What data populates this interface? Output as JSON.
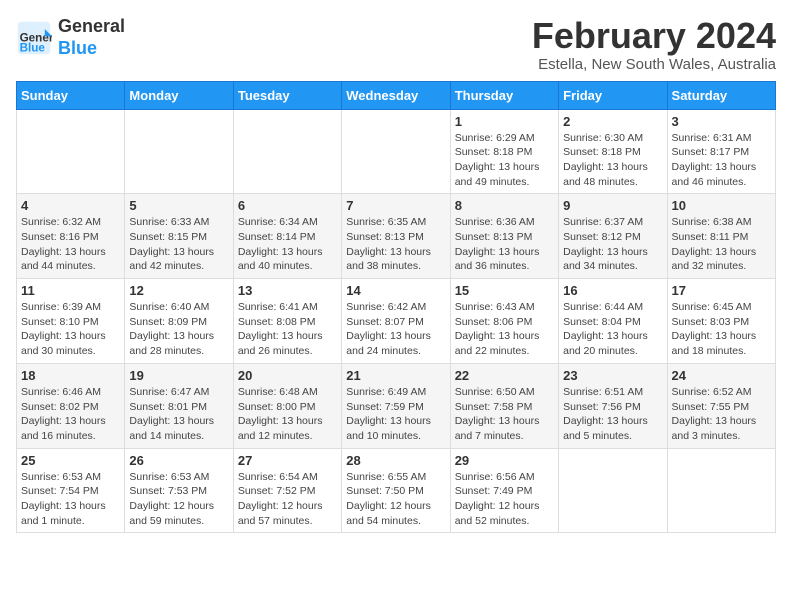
{
  "header": {
    "logo_general": "General",
    "logo_blue": "Blue",
    "month_title": "February 2024",
    "location": "Estella, New South Wales, Australia"
  },
  "days_of_week": [
    "Sunday",
    "Monday",
    "Tuesday",
    "Wednesday",
    "Thursday",
    "Friday",
    "Saturday"
  ],
  "weeks": [
    [
      {
        "day": "",
        "info": ""
      },
      {
        "day": "",
        "info": ""
      },
      {
        "day": "",
        "info": ""
      },
      {
        "day": "",
        "info": ""
      },
      {
        "day": "1",
        "info": "Sunrise: 6:29 AM\nSunset: 8:18 PM\nDaylight: 13 hours\nand 49 minutes."
      },
      {
        "day": "2",
        "info": "Sunrise: 6:30 AM\nSunset: 8:18 PM\nDaylight: 13 hours\nand 48 minutes."
      },
      {
        "day": "3",
        "info": "Sunrise: 6:31 AM\nSunset: 8:17 PM\nDaylight: 13 hours\nand 46 minutes."
      }
    ],
    [
      {
        "day": "4",
        "info": "Sunrise: 6:32 AM\nSunset: 8:16 PM\nDaylight: 13 hours\nand 44 minutes."
      },
      {
        "day": "5",
        "info": "Sunrise: 6:33 AM\nSunset: 8:15 PM\nDaylight: 13 hours\nand 42 minutes."
      },
      {
        "day": "6",
        "info": "Sunrise: 6:34 AM\nSunset: 8:14 PM\nDaylight: 13 hours\nand 40 minutes."
      },
      {
        "day": "7",
        "info": "Sunrise: 6:35 AM\nSunset: 8:13 PM\nDaylight: 13 hours\nand 38 minutes."
      },
      {
        "day": "8",
        "info": "Sunrise: 6:36 AM\nSunset: 8:13 PM\nDaylight: 13 hours\nand 36 minutes."
      },
      {
        "day": "9",
        "info": "Sunrise: 6:37 AM\nSunset: 8:12 PM\nDaylight: 13 hours\nand 34 minutes."
      },
      {
        "day": "10",
        "info": "Sunrise: 6:38 AM\nSunset: 8:11 PM\nDaylight: 13 hours\nand 32 minutes."
      }
    ],
    [
      {
        "day": "11",
        "info": "Sunrise: 6:39 AM\nSunset: 8:10 PM\nDaylight: 13 hours\nand 30 minutes."
      },
      {
        "day": "12",
        "info": "Sunrise: 6:40 AM\nSunset: 8:09 PM\nDaylight: 13 hours\nand 28 minutes."
      },
      {
        "day": "13",
        "info": "Sunrise: 6:41 AM\nSunset: 8:08 PM\nDaylight: 13 hours\nand 26 minutes."
      },
      {
        "day": "14",
        "info": "Sunrise: 6:42 AM\nSunset: 8:07 PM\nDaylight: 13 hours\nand 24 minutes."
      },
      {
        "day": "15",
        "info": "Sunrise: 6:43 AM\nSunset: 8:06 PM\nDaylight: 13 hours\nand 22 minutes."
      },
      {
        "day": "16",
        "info": "Sunrise: 6:44 AM\nSunset: 8:04 PM\nDaylight: 13 hours\nand 20 minutes."
      },
      {
        "day": "17",
        "info": "Sunrise: 6:45 AM\nSunset: 8:03 PM\nDaylight: 13 hours\nand 18 minutes."
      }
    ],
    [
      {
        "day": "18",
        "info": "Sunrise: 6:46 AM\nSunset: 8:02 PM\nDaylight: 13 hours\nand 16 minutes."
      },
      {
        "day": "19",
        "info": "Sunrise: 6:47 AM\nSunset: 8:01 PM\nDaylight: 13 hours\nand 14 minutes."
      },
      {
        "day": "20",
        "info": "Sunrise: 6:48 AM\nSunset: 8:00 PM\nDaylight: 13 hours\nand 12 minutes."
      },
      {
        "day": "21",
        "info": "Sunrise: 6:49 AM\nSunset: 7:59 PM\nDaylight: 13 hours\nand 10 minutes."
      },
      {
        "day": "22",
        "info": "Sunrise: 6:50 AM\nSunset: 7:58 PM\nDaylight: 13 hours\nand 7 minutes."
      },
      {
        "day": "23",
        "info": "Sunrise: 6:51 AM\nSunset: 7:56 PM\nDaylight: 13 hours\nand 5 minutes."
      },
      {
        "day": "24",
        "info": "Sunrise: 6:52 AM\nSunset: 7:55 PM\nDaylight: 13 hours\nand 3 minutes."
      }
    ],
    [
      {
        "day": "25",
        "info": "Sunrise: 6:53 AM\nSunset: 7:54 PM\nDaylight: 13 hours\nand 1 minute."
      },
      {
        "day": "26",
        "info": "Sunrise: 6:53 AM\nSunset: 7:53 PM\nDaylight: 12 hours\nand 59 minutes."
      },
      {
        "day": "27",
        "info": "Sunrise: 6:54 AM\nSunset: 7:52 PM\nDaylight: 12 hours\nand 57 minutes."
      },
      {
        "day": "28",
        "info": "Sunrise: 6:55 AM\nSunset: 7:50 PM\nDaylight: 12 hours\nand 54 minutes."
      },
      {
        "day": "29",
        "info": "Sunrise: 6:56 AM\nSunset: 7:49 PM\nDaylight: 12 hours\nand 52 minutes."
      },
      {
        "day": "",
        "info": ""
      },
      {
        "day": "",
        "info": ""
      }
    ]
  ]
}
